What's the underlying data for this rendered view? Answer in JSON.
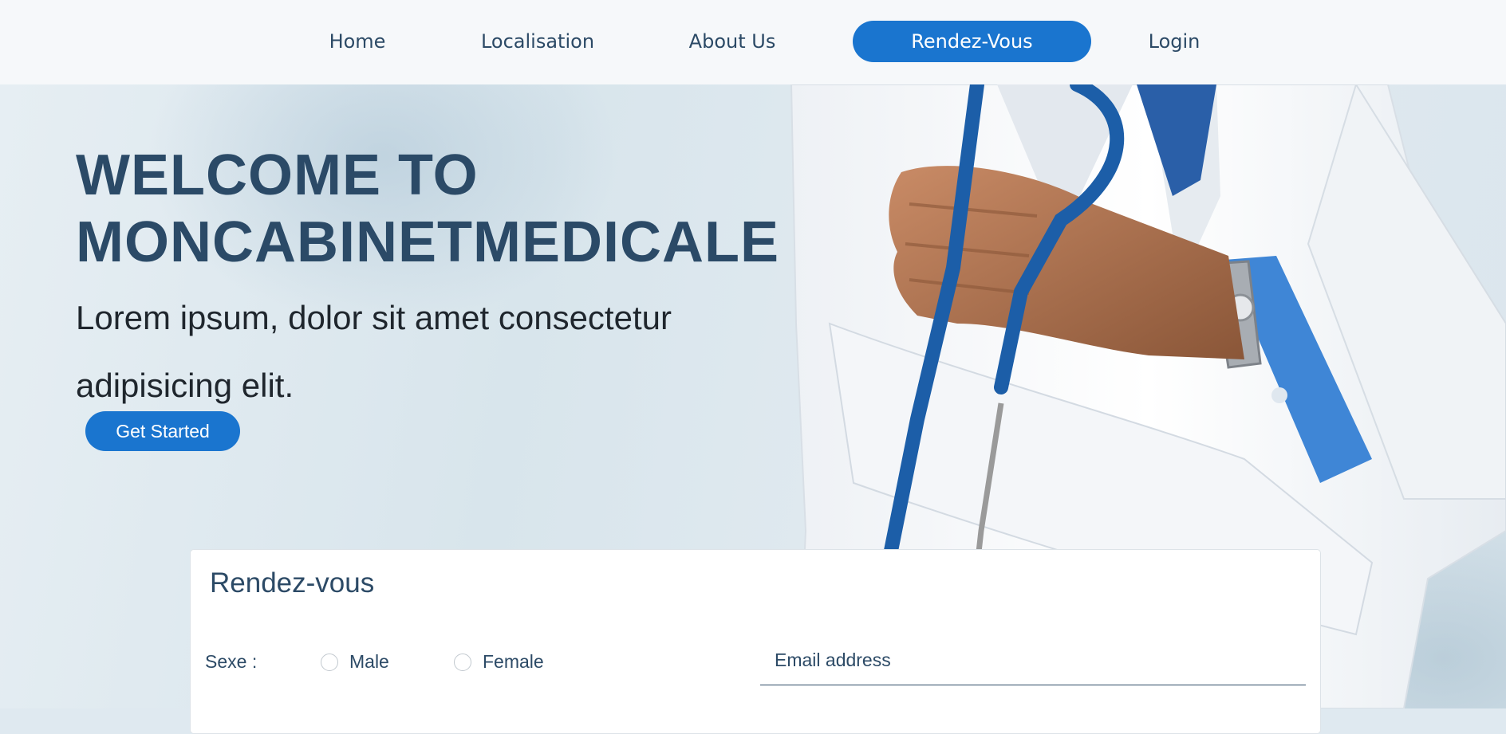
{
  "nav": {
    "items": [
      {
        "label": "Home"
      },
      {
        "label": "Localisation"
      },
      {
        "label": "About Us"
      },
      {
        "label": "Rendez-Vous",
        "active": true
      },
      {
        "label": "Login"
      }
    ]
  },
  "hero": {
    "title_line1": "WELCOME TO",
    "title_line2": "MONCABINETMEDICALE",
    "subtitle": "Lorem ipsum, dolor sit amet consectetur adipisicing elit.",
    "cta_label": "Get Started",
    "image_alt": "doctor with stethoscope"
  },
  "form": {
    "title": "Rendez-vous",
    "sexe_label": "Sexe :",
    "gender_options": [
      "Male",
      "Female"
    ],
    "email_placeholder": "Email address"
  },
  "colors": {
    "primary": "#1a75cf",
    "heading": "#2b4a67",
    "nav_bg": "#f6f8fa"
  }
}
